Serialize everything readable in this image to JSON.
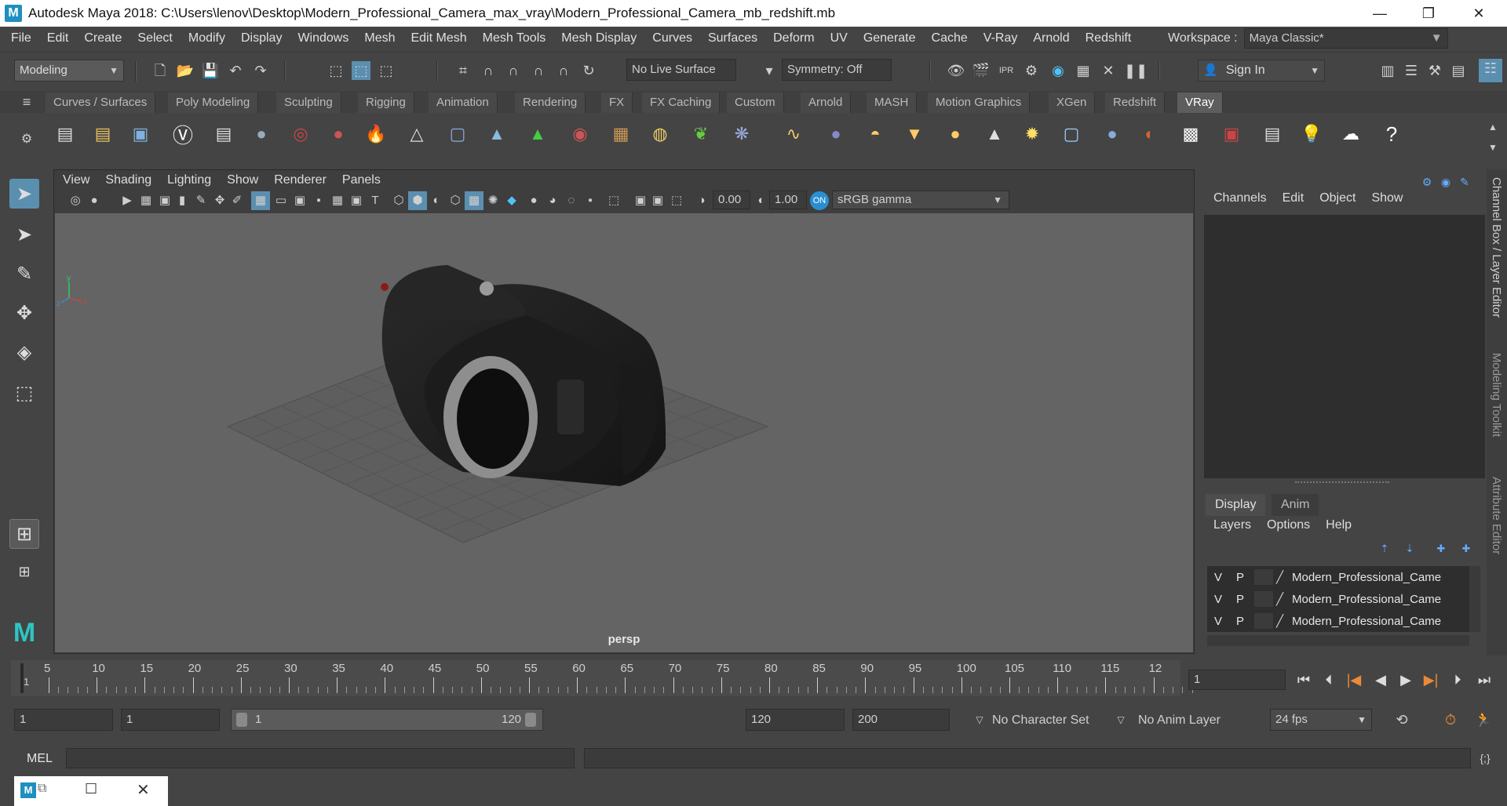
{
  "window": {
    "title": "Autodesk Maya 2018: C:\\Users\\lenov\\Desktop\\Modern_Professional_Camera_max_vray\\Modern_Professional_Camera_mb_redshift.mb",
    "logo": "M",
    "minimize": "—",
    "maximize": "❐",
    "close": "✕"
  },
  "menu": [
    "File",
    "Edit",
    "Create",
    "Select",
    "Modify",
    "Display",
    "Windows",
    "Mesh",
    "Edit Mesh",
    "Mesh Tools",
    "Mesh Display",
    "Curves",
    "Surfaces",
    "Deform",
    "UV",
    "Generate",
    "Cache",
    "V-Ray",
    "Arnold",
    "Redshift"
  ],
  "workspace": {
    "label": "Workspace :",
    "value": "Maya Classic*"
  },
  "statusline": {
    "menuset": "Modeling",
    "live_surface": "No Live Surface",
    "symmetry": "Symmetry: Off",
    "sign_in": "Sign In"
  },
  "shelf_tabs": [
    "Curves / Surfaces",
    "Poly Modeling",
    "Sculpting",
    "Rigging",
    "Animation",
    "Rendering",
    "FX",
    "FX Caching",
    "Custom",
    "Arnold",
    "MASH",
    "Motion Graphics",
    "XGen",
    "Redshift",
    "VRay"
  ],
  "shelf_active": "VRay",
  "viewport": {
    "menus": [
      "View",
      "Shading",
      "Lighting",
      "Show",
      "Renderer",
      "Panels"
    ],
    "exposure": "0.00",
    "gamma": "1.00",
    "color_space": "sRGB gamma",
    "camera_label": "persp"
  },
  "channel_box": {
    "menus": [
      "Channels",
      "Edit",
      "Object",
      "Show"
    ]
  },
  "layer_editor": {
    "tabs": [
      "Display",
      "Anim"
    ],
    "menus": [
      "Layers",
      "Options",
      "Help"
    ],
    "layers": [
      {
        "v": "V",
        "p": "P",
        "name": "Modern_Professional_Came"
      },
      {
        "v": "V",
        "p": "P",
        "name": "Modern_Professional_Came"
      },
      {
        "v": "V",
        "p": "P",
        "name": "Modern_Professional_Came"
      }
    ]
  },
  "side_tabs": [
    "Channel Box / Layer Editor",
    "Modeling Toolkit",
    "Attribute Editor"
  ],
  "timeline": {
    "ticks": [
      "5",
      "10",
      "15",
      "20",
      "25",
      "30",
      "35",
      "40",
      "45",
      "50",
      "55",
      "60",
      "65",
      "70",
      "75",
      "80",
      "85",
      "90",
      "95",
      "100",
      "105",
      "110",
      "115",
      "12"
    ],
    "start_marker": "1",
    "current_frame": "1"
  },
  "range": {
    "start": "1",
    "playback_start": "1",
    "range_start_label": "1",
    "range_end_label": "120",
    "playback_end": "120",
    "end": "200",
    "character_set": "No Character Set",
    "anim_layer": "No Anim Layer",
    "fps": "24 fps"
  },
  "cmdline": {
    "label": "MEL"
  }
}
